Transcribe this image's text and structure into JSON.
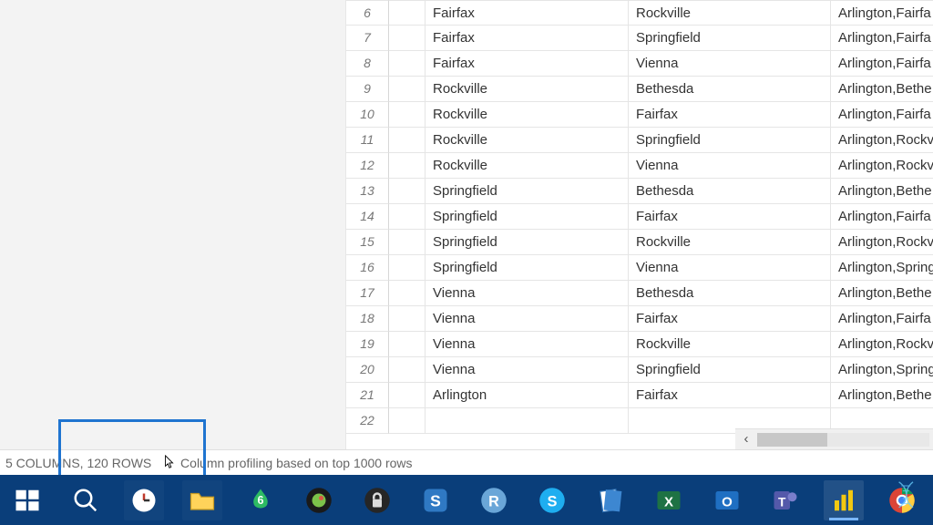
{
  "grid": {
    "rows": [
      {
        "n": "6",
        "c1": "Fairfax",
        "c2": "Rockville",
        "c3": "Arlington,Fairfa"
      },
      {
        "n": "7",
        "c1": "Fairfax",
        "c2": "Springfield",
        "c3": "Arlington,Fairfa"
      },
      {
        "n": "8",
        "c1": "Fairfax",
        "c2": "Vienna",
        "c3": "Arlington,Fairfa"
      },
      {
        "n": "9",
        "c1": "Rockville",
        "c2": "Bethesda",
        "c3": "Arlington,Bethe"
      },
      {
        "n": "10",
        "c1": "Rockville",
        "c2": "Fairfax",
        "c3": "Arlington,Fairfa"
      },
      {
        "n": "11",
        "c1": "Rockville",
        "c2": "Springfield",
        "c3": "Arlington,Rockv"
      },
      {
        "n": "12",
        "c1": "Rockville",
        "c2": "Vienna",
        "c3": "Arlington,Rockv"
      },
      {
        "n": "13",
        "c1": "Springfield",
        "c2": "Bethesda",
        "c3": "Arlington,Bethe"
      },
      {
        "n": "14",
        "c1": "Springfield",
        "c2": "Fairfax",
        "c3": "Arlington,Fairfa"
      },
      {
        "n": "15",
        "c1": "Springfield",
        "c2": "Rockville",
        "c3": "Arlington,Rockv"
      },
      {
        "n": "16",
        "c1": "Springfield",
        "c2": "Vienna",
        "c3": "Arlington,Spring"
      },
      {
        "n": "17",
        "c1": "Vienna",
        "c2": "Bethesda",
        "c3": "Arlington,Bethe"
      },
      {
        "n": "18",
        "c1": "Vienna",
        "c2": "Fairfax",
        "c3": "Arlington,Fairfa"
      },
      {
        "n": "19",
        "c1": "Vienna",
        "c2": "Rockville",
        "c3": "Arlington,Rockv"
      },
      {
        "n": "20",
        "c1": "Vienna",
        "c2": "Springfield",
        "c3": "Arlington,Spring"
      },
      {
        "n": "21",
        "c1": "Arlington",
        "c2": "Fairfax",
        "c3": "Arlington,Bethe"
      },
      {
        "n": "22",
        "c1": "",
        "c2": "",
        "c3": ""
      }
    ]
  },
  "status": {
    "cols_rows": "5 COLUMNS, 120 ROWS",
    "profiling": "Column profiling based on top 1000 rows"
  },
  "scrollbar": {
    "left_glyph": "‹"
  },
  "colors": {
    "taskbar": "#0a3e7a",
    "highlight": "#1f74d0"
  }
}
